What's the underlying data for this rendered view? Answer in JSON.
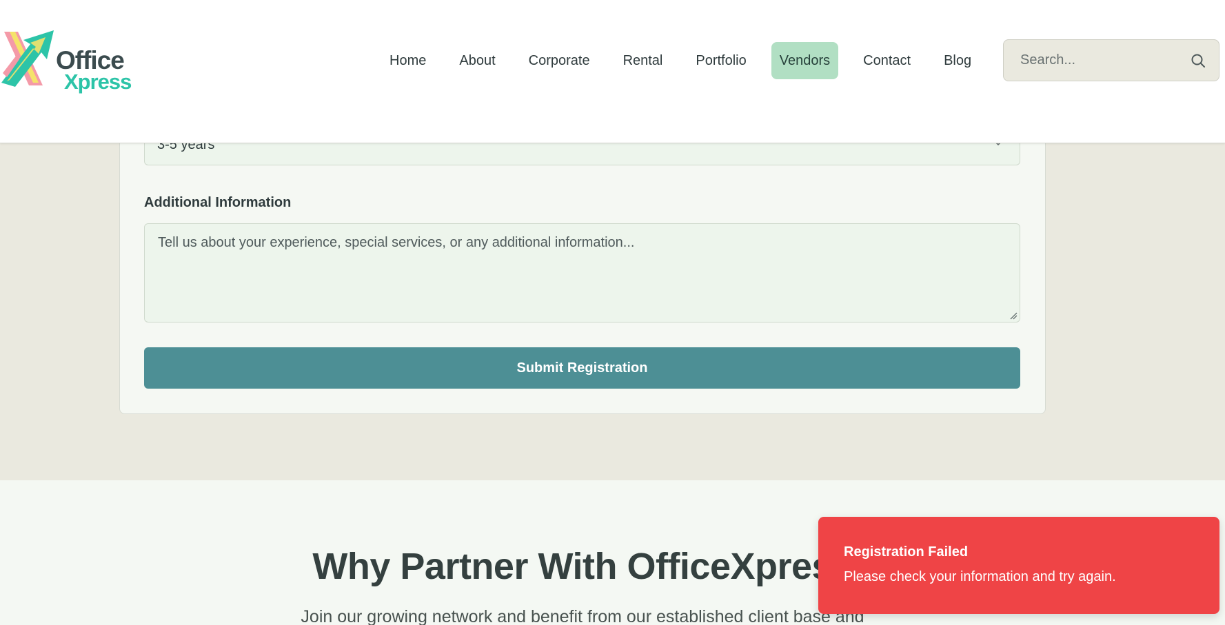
{
  "brand": {
    "name_line1": "Office",
    "name_line2": "Xpress",
    "colors": {
      "dark": "#3b4b4e",
      "teal": "#2dc4a8",
      "pink": "#f49aa8",
      "yellow": "#f5e36a"
    }
  },
  "nav": {
    "items": [
      {
        "label": "Home",
        "active": false
      },
      {
        "label": "About",
        "active": false
      },
      {
        "label": "Corporate",
        "active": false
      },
      {
        "label": "Rental",
        "active": false
      },
      {
        "label": "Portfolio",
        "active": false
      },
      {
        "label": "Vendors",
        "active": true
      },
      {
        "label": "Contact",
        "active": false
      },
      {
        "label": "Blog",
        "active": false
      }
    ],
    "active_color": "#b1dfc3"
  },
  "search": {
    "placeholder": "Search...",
    "icon": "search-icon"
  },
  "form": {
    "experience_value": "3-5 years",
    "additional_label": "Additional Information",
    "additional_placeholder": "Tell us about your experience, special services, or any additional information...",
    "submit_label": "Submit Registration",
    "submit_color": "#4d8f95"
  },
  "why": {
    "title": "Why Partner With OfficeXpress",
    "subtitle": "Join our growing network and benefit from our established client base and"
  },
  "toast": {
    "title": "Registration Failed",
    "message": "Please check your information and try again.",
    "color": "#ef4446"
  }
}
